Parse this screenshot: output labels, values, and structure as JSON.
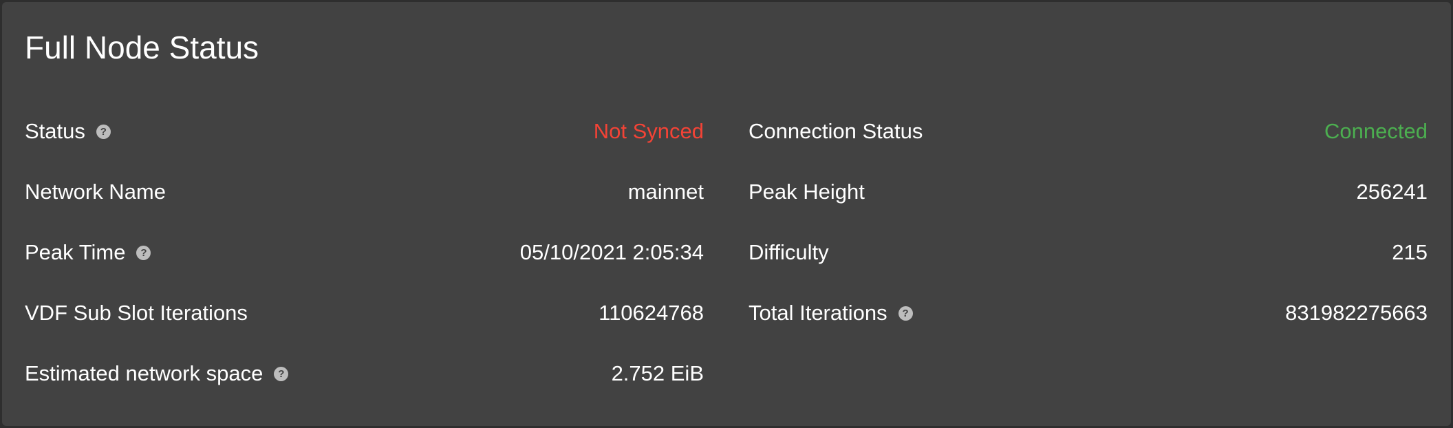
{
  "card": {
    "title": "Full Node Status"
  },
  "colors": {
    "error": "#f44336",
    "success": "#4caf50"
  },
  "left_column": [
    {
      "label": "Status",
      "value": "Not Synced",
      "has_help": true,
      "status": "error"
    },
    {
      "label": "Network Name",
      "value": "mainnet",
      "has_help": false
    },
    {
      "label": "Peak Time",
      "value": "05/10/2021 2:05:34",
      "has_help": true
    },
    {
      "label": "VDF Sub Slot Iterations",
      "value": "110624768",
      "has_help": false
    },
    {
      "label": "Estimated network space",
      "value": "2.752 EiB",
      "has_help": true
    }
  ],
  "right_column": [
    {
      "label": "Connection Status",
      "value": "Connected",
      "has_help": false,
      "status": "success"
    },
    {
      "label": "Peak Height",
      "value": "256241",
      "has_help": false
    },
    {
      "label": "Difficulty",
      "value": "215",
      "has_help": false
    },
    {
      "label": "Total Iterations",
      "value": "831982275663",
      "has_help": true
    }
  ],
  "help_icon": {
    "glyph": "?",
    "icon_name": "help-circle-icon"
  }
}
